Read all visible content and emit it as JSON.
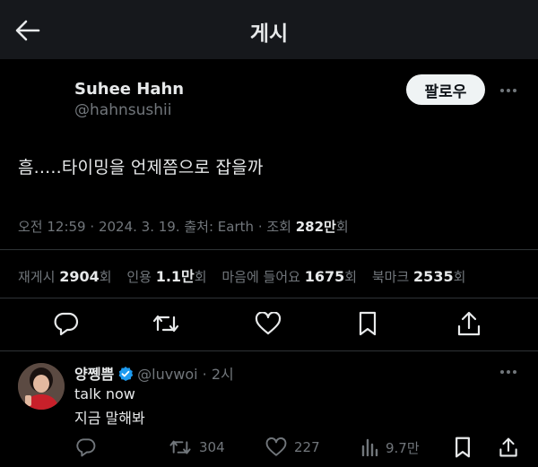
{
  "header": {
    "title": "게시"
  },
  "post": {
    "author_name": "Suhee Hahn",
    "author_handle": "@hahnsushii",
    "follow_label": "팔로우",
    "text": "흠.....타이밍을 언제쯤으로 잡을까",
    "meta": {
      "time": "오전 12:59",
      "date": "2024. 3. 19.",
      "source": "출처: Earth",
      "views_label": "조회",
      "views_value": "282만",
      "views_suffix": "회"
    },
    "stats": {
      "retweets_label": "재게시",
      "retweets_value": "2904",
      "retweets_suffix": "회",
      "quotes_label": "인용",
      "quotes_value": "1.1만",
      "quotes_suffix": "회",
      "likes_label": "마음에 들어요",
      "likes_value": "1675",
      "likes_suffix": "회",
      "bookmarks_label": "북마크",
      "bookmarks_value": "2535",
      "bookmarks_suffix": "회"
    }
  },
  "reply": {
    "author_name": "양쩽쁨",
    "author_handle": "@luvwoi",
    "time": "· 2시",
    "line1": "talk now",
    "line2": "지금 말해봐",
    "retweets": "304",
    "likes": "227",
    "views": "9.7만"
  },
  "colors": {
    "background": "#000000",
    "header": "#16181c",
    "text": "#e7e9ea",
    "muted": "#71767b",
    "verified": "#1d9bf0"
  }
}
